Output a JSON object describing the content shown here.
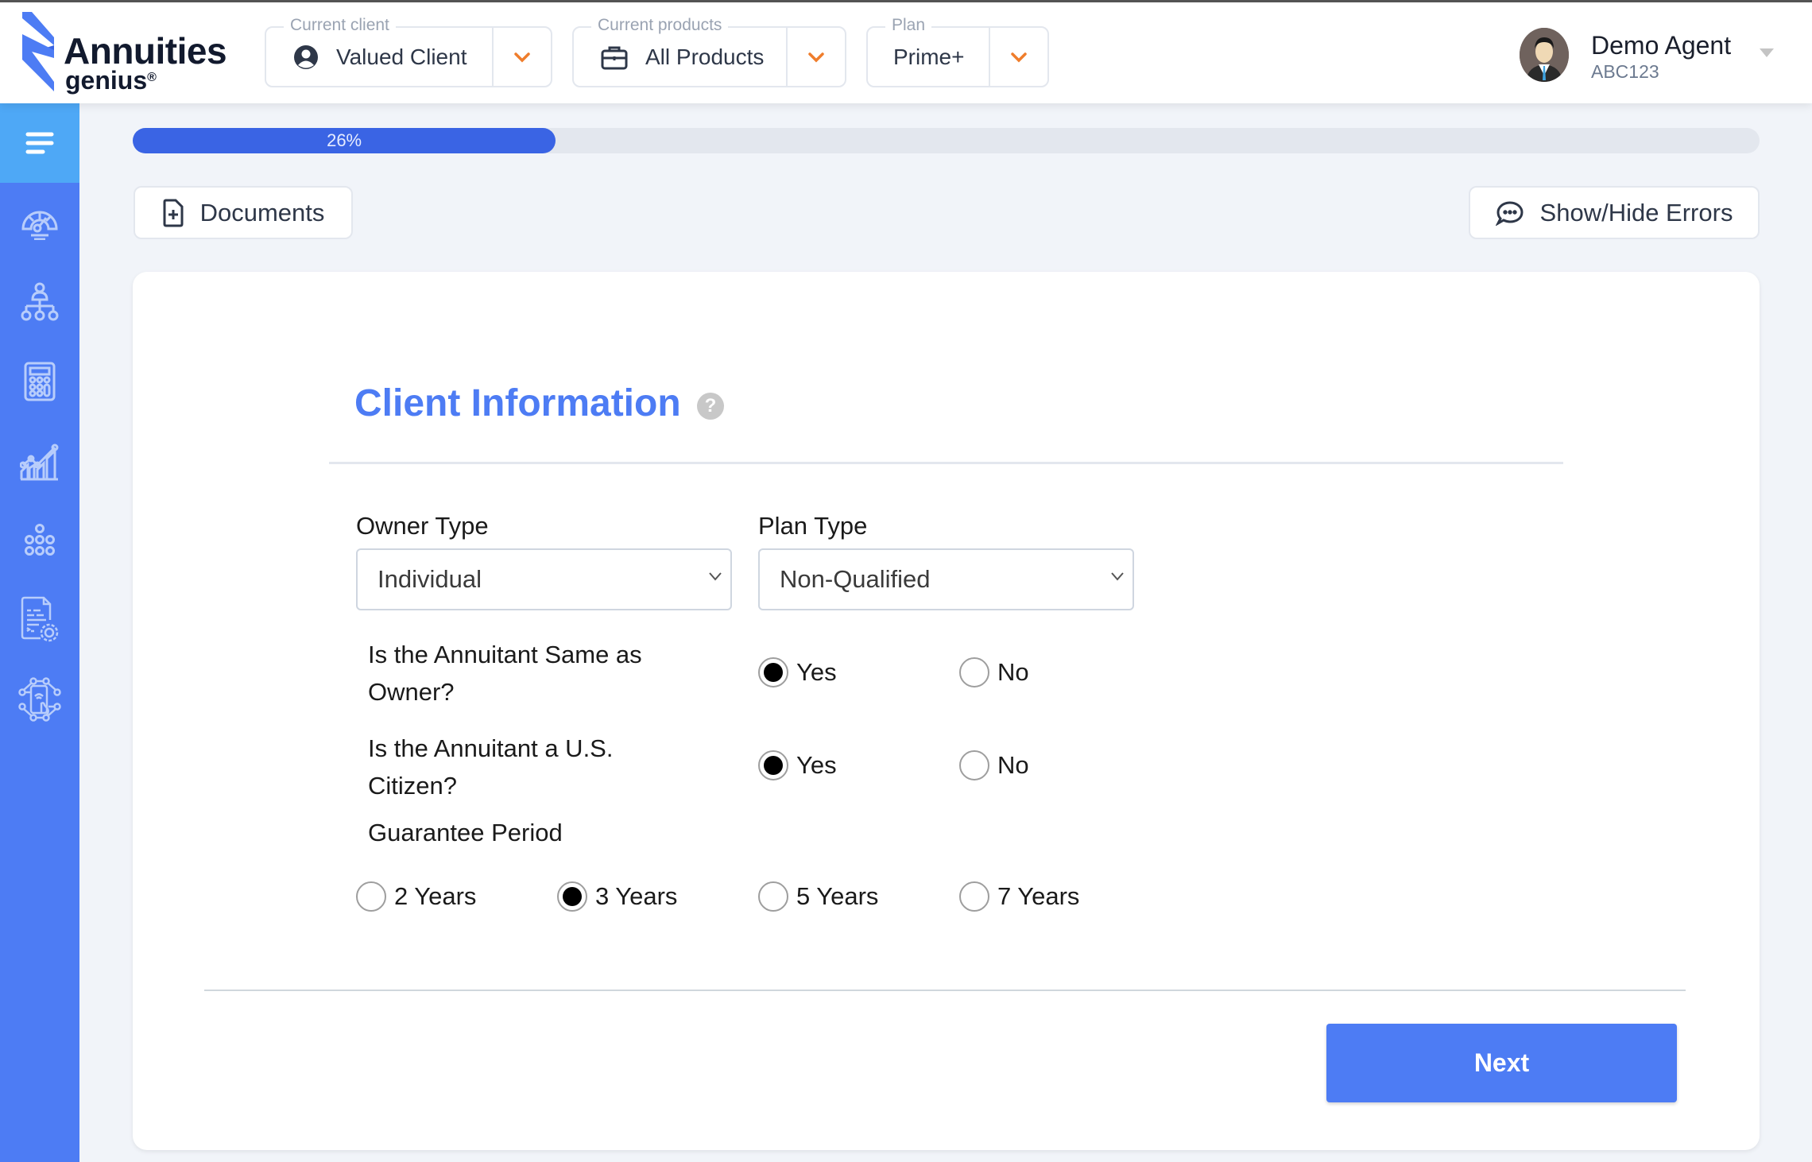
{
  "brand": {
    "name": "Annuities",
    "sub": "genius",
    "reg": "®",
    "accent": "#4d7cf4"
  },
  "header": {
    "current_client": {
      "legend": "Current client",
      "value": "Valued Client",
      "icon": "user-circle-icon"
    },
    "current_products": {
      "legend": "Current products",
      "value": "All Products",
      "icon": "briefcase-icon"
    },
    "plan": {
      "legend": "Plan",
      "value": "Prime+"
    },
    "user": {
      "name": "Demo Agent",
      "code": "ABC123"
    },
    "caret_color": "#ef7d2c"
  },
  "sidebar": {
    "items": [
      {
        "name": "menu",
        "icon": "hamburger-icon"
      },
      {
        "name": "dashboard",
        "icon": "speedometer-icon"
      },
      {
        "name": "hierarchy",
        "icon": "org-chart-icon"
      },
      {
        "name": "calculator",
        "icon": "calculator-icon"
      },
      {
        "name": "analytics",
        "icon": "chart-growth-icon"
      },
      {
        "name": "products",
        "icon": "dots-pyramid-icon"
      },
      {
        "name": "document-settings",
        "icon": "document-gear-icon"
      },
      {
        "name": "network",
        "icon": "mobile-network-icon"
      }
    ]
  },
  "progress": {
    "percent": 26,
    "label": "26%"
  },
  "toolbar": {
    "documents_label": "Documents",
    "errors_label": "Show/Hide Errors"
  },
  "form": {
    "title": "Client Information",
    "help_glyph": "?",
    "owner_type": {
      "label": "Owner Type",
      "value": "Individual"
    },
    "plan_type": {
      "label": "Plan Type",
      "value": "Non-Qualified"
    },
    "same_as_owner": {
      "question": "Is the Annuitant Same as Owner?",
      "options": [
        "Yes",
        "No"
      ],
      "selected": "Yes"
    },
    "us_citizen": {
      "question": "Is the Annuitant a U.S. Citizen?",
      "options": [
        "Yes",
        "No"
      ],
      "selected": "Yes"
    },
    "guarantee_period": {
      "label": "Guarantee Period",
      "options": [
        "2 Years",
        "3 Years",
        "5 Years",
        "7 Years"
      ],
      "selected": "3 Years"
    },
    "next_label": "Next"
  }
}
